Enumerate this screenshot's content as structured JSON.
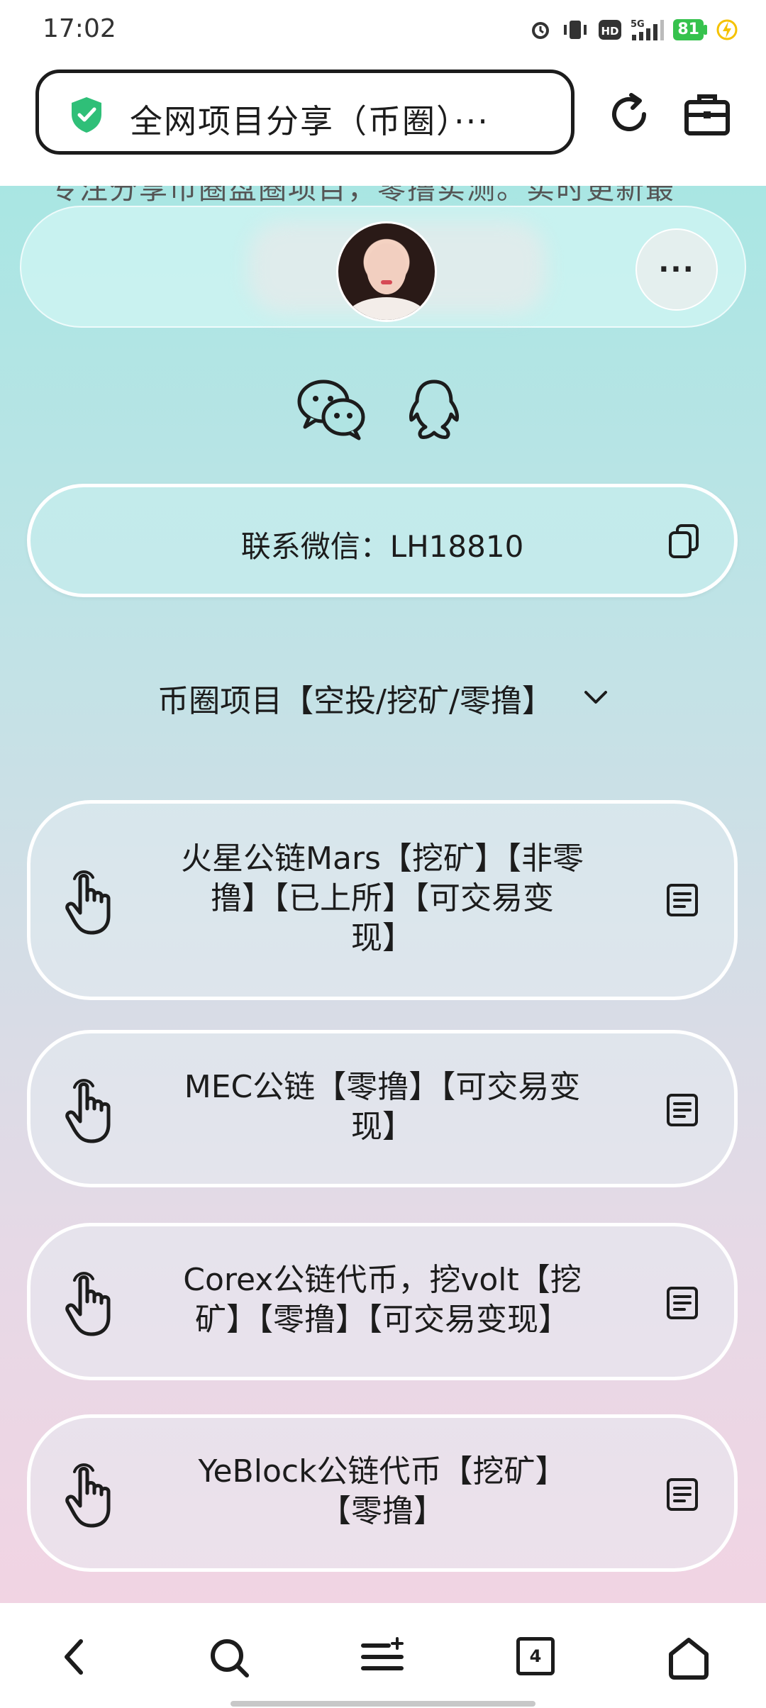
{
  "status_bar": {
    "time": "17:02",
    "icons": [
      "alarm-icon",
      "vibrate-icon",
      "hd-icon",
      "signal-5g-icon",
      "battery-icon",
      "charging-icon"
    ],
    "hd_label": "HD",
    "network_label": "5G",
    "battery_level": "81",
    "battery_color": "#36c24d"
  },
  "browser": {
    "title": "全网项目分享（币圈）···",
    "secure_color": "#2fbf78",
    "icons": [
      "shield-check-icon",
      "reload-icon",
      "toolbox-icon"
    ]
  },
  "page": {
    "description": "专注分享币圈盘圈项目，零撸实测。实时更新最",
    "profile": {
      "more_label": "···"
    },
    "social_icons": [
      "wechat-icon",
      "qq-icon"
    ],
    "contact": {
      "label": "联系微信：LH18810"
    },
    "section": {
      "title": "币圈项目【空投/挖矿/零撸】"
    },
    "items": [
      {
        "line1": "火星公链Mars【挖矿】【非零",
        "line2": "撸】【已上所】【可交易变",
        "line3": "现】"
      },
      {
        "line1": "MEC公链【零撸】【可交易变",
        "line2": "现】"
      },
      {
        "line1": "Corex公链代币，挖volt【挖",
        "line2": "矿】【零撸】【可交易变现】"
      },
      {
        "line1": "YeBlock公链代币【挖矿】",
        "line2": "【零撸】"
      }
    ]
  },
  "bottom_nav": {
    "tab_count": "4",
    "icons": [
      "back-icon",
      "search-icon",
      "menu-icon",
      "tabs-icon",
      "home-icon"
    ]
  },
  "colors": {
    "gradient_top": "#a9e6e3",
    "gradient_bottom": "#f1d4e3"
  }
}
